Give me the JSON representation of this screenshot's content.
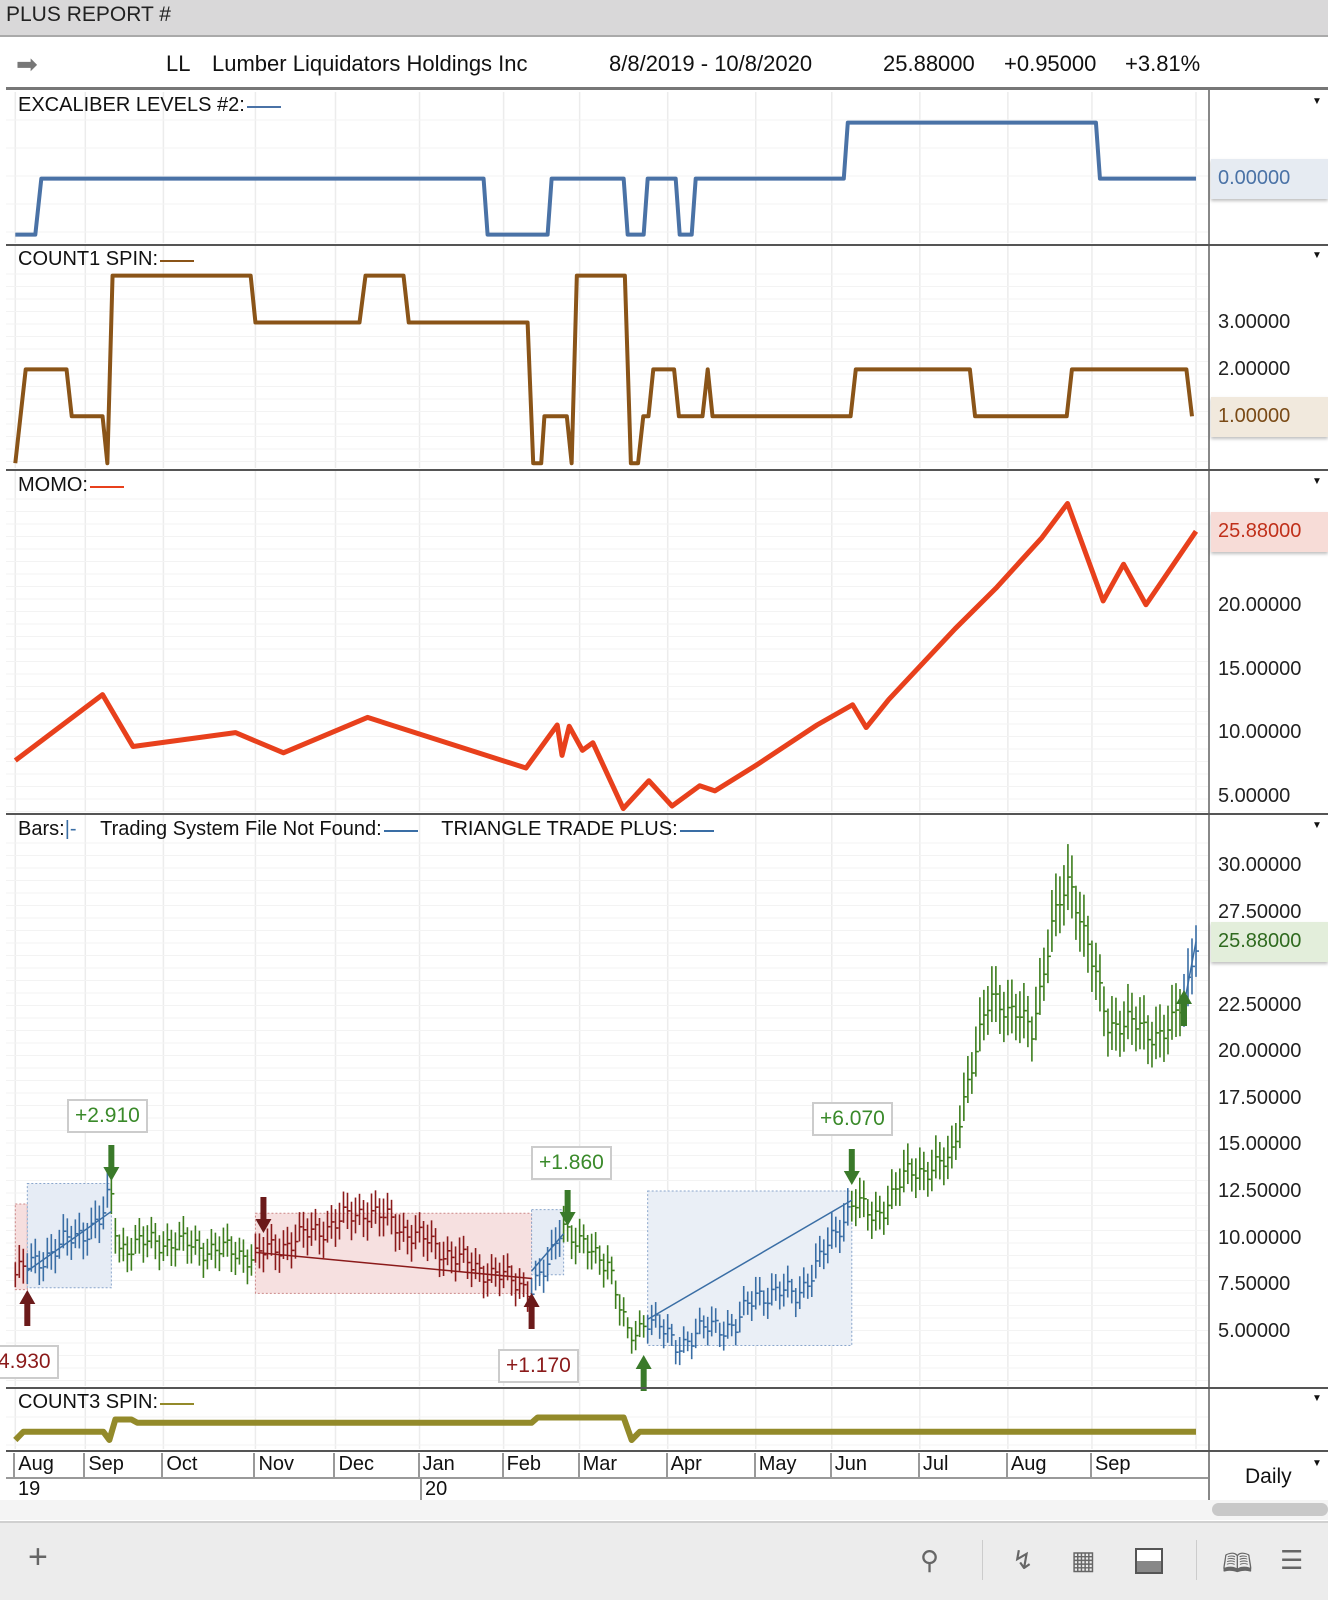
{
  "window": {
    "title": "PLUS REPORT #"
  },
  "header": {
    "symbol": "LL",
    "company": "Lumber Liquidators Holdings Inc",
    "date_range": "8/8/2019 - 10/8/2020",
    "last": "25.88000",
    "change": "+0.95000",
    "pct_change": "+3.81%"
  },
  "panels": {
    "excaliber": {
      "label": "EXCALIBER LEVELS #2:",
      "value": "0.00000",
      "color": "#4a72a6"
    },
    "count1": {
      "label": "COUNT1 SPIN:",
      "ticks": [
        "3.00000",
        "2.00000"
      ],
      "value": "1.00000",
      "color": "#8a5418"
    },
    "momo": {
      "label": "MOMO:",
      "ticks": [
        "20.00000",
        "15.00000",
        "10.00000",
        "5.00000"
      ],
      "value": "25.88000",
      "color": "#e8401c"
    },
    "bars": {
      "label_bars": "Bars:",
      "label_bars_sym": "|-",
      "label_tsf": "Trading System File Not Found:",
      "label_ttp": "TRIANGLE TRADE PLUS:",
      "ticks": [
        "30.00000",
        "27.50000",
        "22.50000",
        "20.00000",
        "17.50000",
        "15.00000",
        "12.50000",
        "10.00000",
        "7.50000",
        "5.00000"
      ],
      "value": "25.88000"
    },
    "count3": {
      "label": "COUNT3 SPIN:",
      "color": "#938a2a"
    }
  },
  "trades": [
    {
      "label": "+2.910",
      "color": "#3a8a2a"
    },
    {
      "label": "4.930",
      "color": "#8b1a1a"
    },
    {
      "label": "+1.170",
      "color": "#8b1a1a"
    },
    {
      "label": "+1.860",
      "color": "#3a8a2a"
    },
    {
      "label": "+6.070",
      "color": "#3a8a2a"
    }
  ],
  "time_axis": {
    "months": [
      "Aug",
      "Sep",
      "Oct",
      "Nov",
      "Dec",
      "Jan",
      "Feb",
      "Mar",
      "Apr",
      "May",
      "Jun",
      "Jul",
      "Aug",
      "Sep"
    ],
    "years": [
      "19",
      "20"
    ],
    "period": "Daily"
  },
  "chart_data": [
    {
      "type": "line",
      "title": "EXCALIBER LEVELS #2",
      "x_unit": "trading day",
      "points": [
        [
          0,
          -1
        ],
        [
          5,
          -1
        ],
        [
          6.5,
          0
        ],
        [
          117,
          0
        ],
        [
          118,
          -1
        ],
        [
          133,
          -1
        ],
        [
          134,
          0
        ],
        [
          152,
          0
        ],
        [
          153,
          -1
        ],
        [
          157,
          -1
        ],
        [
          158,
          0
        ],
        [
          165,
          0
        ],
        [
          166,
          -1
        ],
        [
          169,
          -1
        ],
        [
          170,
          0
        ],
        [
          207,
          0
        ],
        [
          208,
          1
        ],
        [
          270,
          1
        ],
        [
          271,
          0
        ],
        [
          295,
          0
        ]
      ]
    },
    {
      "type": "line",
      "title": "COUNT1 SPIN",
      "points": [
        [
          0,
          0
        ],
        [
          2.6,
          2
        ],
        [
          12.8,
          2
        ],
        [
          14.1,
          1
        ],
        [
          21.8,
          1
        ],
        [
          23,
          0
        ],
        [
          24.3,
          4
        ],
        [
          58.8,
          4
        ],
        [
          60,
          3
        ],
        [
          86,
          3
        ],
        [
          87.5,
          4
        ],
        [
          97,
          4
        ],
        [
          98.3,
          3
        ],
        [
          128,
          3
        ],
        [
          129.4,
          0
        ],
        [
          131.4,
          0
        ],
        [
          132.2,
          1
        ],
        [
          137.8,
          1
        ],
        [
          139,
          0
        ],
        [
          140.3,
          4
        ],
        [
          152.3,
          4
        ],
        [
          153.8,
          0
        ],
        [
          155.6,
          0
        ],
        [
          156.9,
          1
        ],
        [
          158.2,
          1
        ],
        [
          159.4,
          2
        ],
        [
          164.6,
          2
        ],
        [
          165.8,
          1
        ],
        [
          171.7,
          1
        ],
        [
          173,
          2
        ],
        [
          174.2,
          1
        ],
        [
          208.7,
          1
        ],
        [
          210,
          2
        ],
        [
          238.5,
          2
        ],
        [
          239.8,
          1
        ],
        [
          262.7,
          1
        ],
        [
          264,
          2
        ],
        [
          292.6,
          2
        ],
        [
          294,
          1
        ]
      ]
    },
    {
      "type": "line",
      "title": "MOMO",
      "points": [
        [
          0,
          7.8
        ],
        [
          21.8,
          13.0
        ],
        [
          29.4,
          8.9
        ],
        [
          55,
          10
        ],
        [
          67,
          8.4
        ],
        [
          88,
          11.2
        ],
        [
          127.6,
          7.2
        ],
        [
          135.4,
          10.6
        ],
        [
          136.6,
          8.2
        ],
        [
          138.4,
          10.5
        ],
        [
          141.7,
          8.6
        ],
        [
          144.3,
          9.2
        ],
        [
          151.9,
          4.0
        ],
        [
          158.3,
          6.2
        ],
        [
          164.1,
          4.2
        ],
        [
          171,
          5.8
        ],
        [
          174.8,
          5.4
        ],
        [
          185,
          7.4
        ],
        [
          200.3,
          10.6
        ],
        [
          209.2,
          12.2
        ],
        [
          212.6,
          10.4
        ],
        [
          218.2,
          12.6
        ],
        [
          234.8,
          18.2
        ],
        [
          245,
          21.4
        ],
        [
          256.5,
          25.4
        ],
        [
          262.9,
          28.1
        ],
        [
          271.8,
          20.4
        ],
        [
          276.9,
          23.3
        ],
        [
          282.5,
          20.1
        ],
        [
          295,
          25.9
        ]
      ]
    },
    {
      "type": "ohlc",
      "title": "LL price",
      "close_points": [
        [
          0,
          8.0
        ],
        [
          21.8,
          11.0
        ],
        [
          23.8,
          12.5
        ],
        [
          25.6,
          9.5
        ],
        [
          37,
          9.8
        ],
        [
          60,
          9.0
        ],
        [
          88,
          11.5
        ],
        [
          113.6,
          8.5
        ],
        [
          129,
          7.3
        ],
        [
          132.8,
          8.2
        ],
        [
          136.6,
          11
        ],
        [
          140.4,
          9.6
        ],
        [
          148.1,
          8.8
        ],
        [
          150.6,
          6.5
        ],
        [
          153.2,
          4.5
        ],
        [
          158.3,
          5.8
        ],
        [
          164.7,
          4.2
        ],
        [
          174.9,
          5.3
        ],
        [
          180,
          5.2
        ],
        [
          185.1,
          7
        ],
        [
          195.3,
          7.0
        ],
        [
          200.4,
          8.5
        ],
        [
          209.3,
          12.0
        ],
        [
          214.4,
          11
        ],
        [
          223.4,
          13.5
        ],
        [
          233.6,
          14
        ],
        [
          237.4,
          18
        ],
        [
          243.8,
          23
        ],
        [
          250.2,
          22
        ],
        [
          254,
          21
        ],
        [
          259.1,
          27
        ],
        [
          263.4,
          29
        ],
        [
          268,
          26
        ],
        [
          273.1,
          21
        ],
        [
          278.2,
          22
        ],
        [
          283.3,
          20.5
        ],
        [
          292.3,
          22.5
        ],
        [
          295,
          25.9
        ]
      ],
      "segments": [
        {
          "from": 0,
          "to": 3,
          "type": "short"
        },
        {
          "from": 3,
          "to": 24,
          "type": "long"
        },
        {
          "from": 24,
          "to": 60,
          "type": "flat"
        },
        {
          "from": 60,
          "to": 129,
          "type": "short"
        },
        {
          "from": 129,
          "to": 137,
          "type": "long"
        },
        {
          "from": 137,
          "to": 158,
          "type": "flat"
        },
        {
          "from": 158,
          "to": 209,
          "type": "long"
        },
        {
          "from": 209,
          "to": 292,
          "type": "flat"
        },
        {
          "from": 292,
          "to": 295,
          "type": "long"
        }
      ],
      "ylim": [
        3,
        31
      ]
    },
    {
      "type": "line",
      "title": "COUNT3 SPIN",
      "points": [
        [
          0,
          0
        ],
        [
          2,
          1
        ],
        [
          22,
          1
        ],
        [
          23.5,
          0
        ],
        [
          25,
          2.5
        ],
        [
          29,
          2.5
        ],
        [
          30.5,
          2.1
        ],
        [
          129,
          2.1
        ],
        [
          130.5,
          2.75
        ],
        [
          152,
          2.75
        ],
        [
          154,
          0
        ],
        [
          156,
          1
        ],
        [
          295,
          1
        ]
      ]
    }
  ]
}
